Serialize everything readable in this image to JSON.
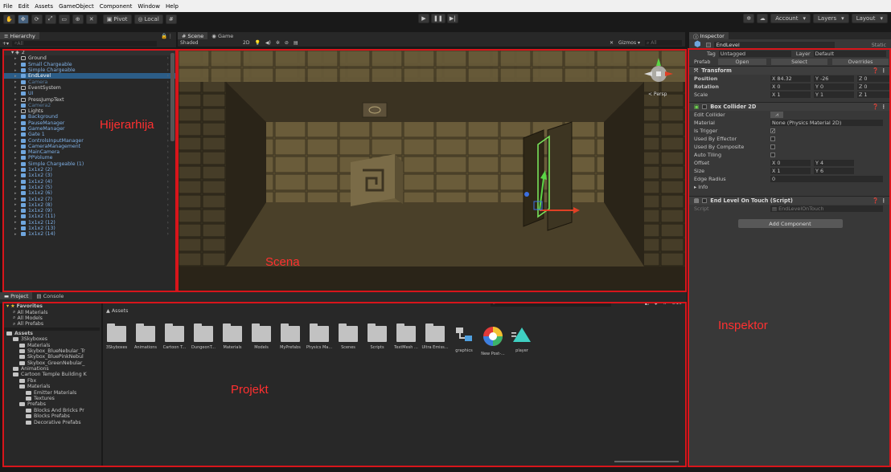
{
  "menu": [
    "File",
    "Edit",
    "Assets",
    "GameObject",
    "Component",
    "Window",
    "Help"
  ],
  "toolbar": {
    "pivot_label": "Pivot",
    "local_label": "Local",
    "account_label": "Account",
    "layers_label": "Layers",
    "layout_label": "Layout"
  },
  "hierarchy": {
    "tab_label": "Hierarchy",
    "search_placeholder": "All",
    "scene_name": "2",
    "rows": [
      {
        "label": "Ground",
        "style": "white"
      },
      {
        "label": "Small Chargeable",
        "style": "blue"
      },
      {
        "label": "Simple Chargeable",
        "style": "blue"
      },
      {
        "label": "EndLevel",
        "style": "selected"
      },
      {
        "label": "Camera",
        "style": "dim"
      },
      {
        "label": "EventSystem",
        "style": "white"
      },
      {
        "label": "UI",
        "style": "blue"
      },
      {
        "label": "PressJumpText",
        "style": "white"
      },
      {
        "label": "Camera2",
        "style": "dim"
      },
      {
        "label": "Lights",
        "style": "white"
      },
      {
        "label": "Background",
        "style": "blue"
      },
      {
        "label": "PauseManager",
        "style": "blue"
      },
      {
        "label": "GameManager",
        "style": "blue"
      },
      {
        "label": "Gate 1",
        "style": "blue"
      },
      {
        "label": "ControlsInputManager",
        "style": "blue"
      },
      {
        "label": "CameraManagement",
        "style": "blue"
      },
      {
        "label": "MainCamera",
        "style": "blue"
      },
      {
        "label": "PPVolume",
        "style": "blue"
      },
      {
        "label": "Simple Chargeable (1)",
        "style": "blue"
      },
      {
        "label": "1x1x2 (2)",
        "style": "blue"
      },
      {
        "label": "1x1x2 (3)",
        "style": "blue"
      },
      {
        "label": "1x1x2 (4)",
        "style": "blue"
      },
      {
        "label": "1x1x2 (5)",
        "style": "blue"
      },
      {
        "label": "1x1x2 (6)",
        "style": "blue"
      },
      {
        "label": "1x1x2 (7)",
        "style": "blue"
      },
      {
        "label": "1x1x2 (8)",
        "style": "blue"
      },
      {
        "label": "1x1x2 (9)",
        "style": "blue"
      },
      {
        "label": "1x1x2 (11)",
        "style": "blue"
      },
      {
        "label": "1x1x2 (12)",
        "style": "blue"
      },
      {
        "label": "1x1x2 (13)",
        "style": "blue"
      },
      {
        "label": "1x1x2 (14)",
        "style": "blue"
      }
    ]
  },
  "scene": {
    "tab_scene": "Scene",
    "tab_game": "Game",
    "shading": "Shaded",
    "mode_2d": "2D",
    "gizmos": "Gizmos",
    "search_placeholder": "All",
    "persp_label": "< Persp"
  },
  "project": {
    "tab_project": "Project",
    "tab_console": "Console",
    "breadcrumb": "Assets",
    "count": "10",
    "tree": [
      {
        "label": "Favorites",
        "level": 0,
        "type": "star"
      },
      {
        "label": "All Materials",
        "level": 1,
        "type": "search"
      },
      {
        "label": "All Models",
        "level": 1,
        "type": "search"
      },
      {
        "label": "All Prefabs",
        "level": 1,
        "type": "search"
      },
      {
        "label": "",
        "level": 0,
        "type": "gap"
      },
      {
        "label": "Assets",
        "level": 0,
        "type": "folder"
      },
      {
        "label": "3Skyboxes",
        "level": 1,
        "type": "folder"
      },
      {
        "label": "Materials",
        "level": 2,
        "type": "folder"
      },
      {
        "label": "Skybox_BlueNebular_Tr",
        "level": 2,
        "type": "folder"
      },
      {
        "label": "Skybox_BluePinkNebul",
        "level": 2,
        "type": "folder"
      },
      {
        "label": "Skybox_GreenNebular_",
        "level": 2,
        "type": "folder"
      },
      {
        "label": "Animations",
        "level": 1,
        "type": "folder"
      },
      {
        "label": "Cartoon Temple Building K",
        "level": 1,
        "type": "folder"
      },
      {
        "label": "Fbx",
        "level": 2,
        "type": "folder"
      },
      {
        "label": "Materials",
        "level": 2,
        "type": "folder"
      },
      {
        "label": "Emitter Materials",
        "level": 3,
        "type": "folder"
      },
      {
        "label": "Textures",
        "level": 3,
        "type": "folder"
      },
      {
        "label": "Prefabs",
        "level": 2,
        "type": "folder"
      },
      {
        "label": "Blocks And Bricks Pr",
        "level": 3,
        "type": "folder"
      },
      {
        "label": "Blocks Prefabs",
        "level": 3,
        "type": "folder"
      },
      {
        "label": "Decorative Prefabs",
        "level": 3,
        "type": "folder"
      }
    ],
    "assets": [
      {
        "label": "3Skyboxes",
        "kind": "folder"
      },
      {
        "label": "Animations",
        "kind": "folder"
      },
      {
        "label": "Cartoon T...",
        "kind": "folder"
      },
      {
        "label": "DungeonT...",
        "kind": "folder"
      },
      {
        "label": "Materials",
        "kind": "folder"
      },
      {
        "label": "Models",
        "kind": "folder"
      },
      {
        "label": "MyPrefabs",
        "kind": "folder"
      },
      {
        "label": "Physics Ma...",
        "kind": "folder"
      },
      {
        "label": "Scenes",
        "kind": "folder"
      },
      {
        "label": "Scripts",
        "kind": "folder"
      },
      {
        "label": "TextMesh ...",
        "kind": "folder"
      },
      {
        "label": "Ultra Emiss...",
        "kind": "folder"
      },
      {
        "label": "graphics",
        "kind": "graph"
      },
      {
        "label": "New Post-...",
        "kind": "post"
      },
      {
        "label": "player",
        "kind": "player"
      }
    ]
  },
  "inspector": {
    "tab_label": "Inspector",
    "object_name": "EndLevel",
    "static_label": "Static",
    "tag_label": "Tag",
    "tag_value": "Untagged",
    "layer_label": "Layer",
    "layer_value": "Default",
    "prefab_label": "Prefab",
    "open_label": "Open",
    "select_label": "Select",
    "overrides_label": "Overrides",
    "transform": {
      "title": "Transform",
      "position_label": "Position",
      "rotation_label": "Rotation",
      "scale_label": "Scale",
      "position": {
        "x": "84.32",
        "y": "-26",
        "z": "0"
      },
      "rotation": {
        "x": "0",
        "y": "0",
        "z": "0"
      },
      "scale": {
        "x": "1",
        "y": "1",
        "z": "1"
      }
    },
    "box_collider": {
      "title": "Box Collider 2D",
      "edit_collider": "Edit Collider",
      "material_label": "Material",
      "material_value": "None (Physics Material 2D)",
      "is_trigger": "Is Trigger",
      "used_by_effector": "Used By Effector",
      "used_by_composite": "Used By Composite",
      "auto_tiling": "Auto Tiling",
      "offset_label": "Offset",
      "offset": {
        "x": "0",
        "y": "4"
      },
      "size_label": "Size",
      "size": {
        "x": "1",
        "y": "6"
      },
      "edge_radius_label": "Edge Radius",
      "edge_radius": "0",
      "info_label": "Info"
    },
    "script_comp": {
      "title": "End Level On Touch (Script)",
      "script_label": "Script",
      "script_value": "EndLevelOnTouch"
    },
    "add_component": "Add Component"
  },
  "overlay_labels": {
    "hierarchy": "Hijerarhija",
    "scene": "Scena",
    "project": "Projekt",
    "inspector": "Inspektor"
  },
  "colors": {
    "frame": "#d8151b",
    "selection": "#2c5d87",
    "hier_blue": "#7fb0e6"
  }
}
